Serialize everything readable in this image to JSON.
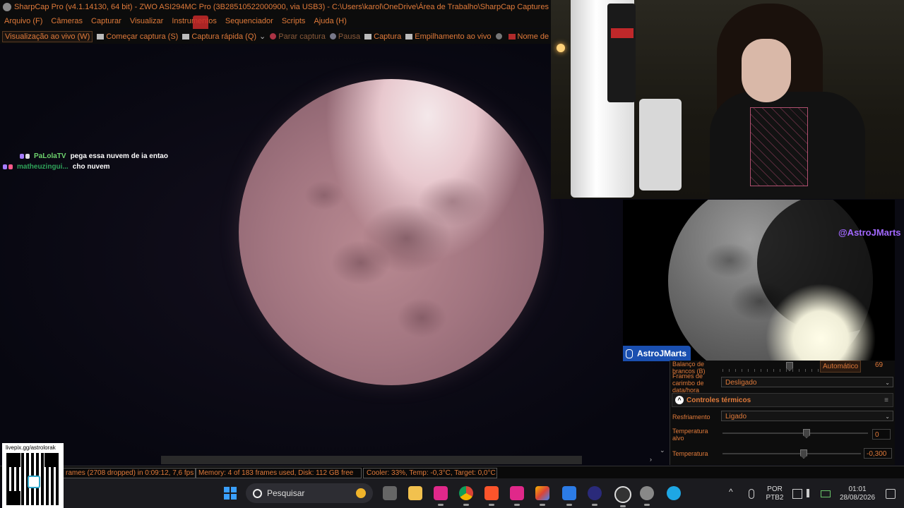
{
  "window": {
    "title": "SharpCap Pro (v4.1.14130, 64 bit) - ZWO ASI294MC Pro (3B28510522000900, via USB3) - C:\\Users\\karol\\OneDrive\\Área de Trabalho\\SharpCap Captures"
  },
  "menu": {
    "items": [
      "Arquivo (F)",
      "Câmeras",
      "Capturar",
      "Visualizar",
      "Instrumentos",
      "Sequenciador",
      "Scripts",
      "Ajuda (H)"
    ]
  },
  "toolbar": {
    "live_view": "Visualização ao vivo (W)",
    "start_capture": "Começar captura (S)",
    "quick_capture": "Captura rápida (Q)",
    "stop_capture": "Parar captura",
    "pause": "Pausa",
    "snapshot": "Captura",
    "live_stack": "Empilhamento ao vivo",
    "target_name": "Nome de destino"
  },
  "chat": {
    "messages": [
      {
        "user": "PaLolaTV",
        "text": "pega essa nuvem de ia entao"
      },
      {
        "user": "matheuzingui...",
        "text": "cho nuvem"
      }
    ]
  },
  "overlay": {
    "handle": "@AstroJMarts",
    "nameplate": "AstroJMarts"
  },
  "panel": {
    "white_balance_label": "Balanço de brancos (B)",
    "white_balance_auto": "Automático",
    "white_balance_value": "69",
    "timestamp_label": "Frames de carimbo de data/hora",
    "timestamp_value": "Desligado",
    "thermal_section": "Controles térmicos",
    "cooling_label": "Resfriamento",
    "cooling_value": "Ligado",
    "target_temp_label": "Temperatura alvo",
    "target_temp_value": "0",
    "temp_label": "Temperatura",
    "temp_value": "-0,300"
  },
  "status": {
    "frames": "rames (2708 dropped) in 0:09:12, 7,6 fps",
    "memory": "Memory: 4 of 183 frames used, Disk: 112 GB free",
    "cooler": "Cooler: 33%, Temp: -0,3°C, Target: 0,0°C"
  },
  "qr": {
    "label": "livepix.gg/astrolorak"
  },
  "taskbar": {
    "search_placeholder": "Pesquisar",
    "lang_top": "POR",
    "lang_bottom": "PTB2",
    "time": "01:01",
    "date": "28/08/2026"
  },
  "colors": {
    "accent": "#e07a3a",
    "chat_user1": "#6ed36e",
    "handle": "#a268ff",
    "nameplate": "#1a4fb0"
  }
}
